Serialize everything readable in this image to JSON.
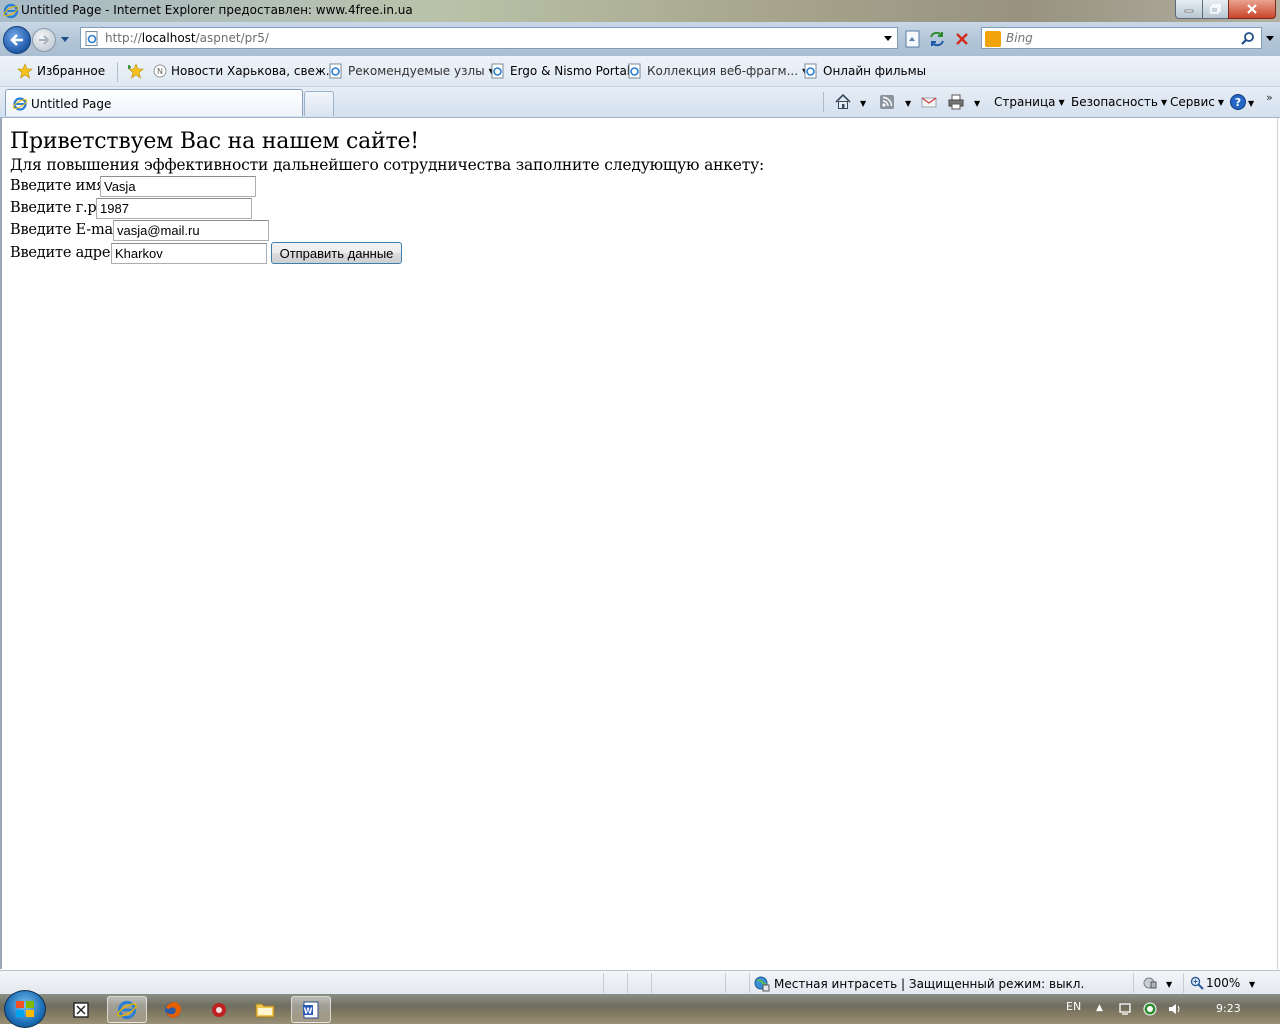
{
  "window": {
    "title": "Untitled Page - Internet Explorer предоставлен: www.4free.in.ua"
  },
  "nav": {
    "url_prefix": "http://",
    "url_host": "localhost",
    "url_path": "/aspnet/pr5/",
    "search_placeholder": "Bing"
  },
  "favorites": {
    "label": "Избранное",
    "items": [
      {
        "label": "Новости Харькова, свеж..."
      },
      {
        "label": "Рекомендуемые узлы"
      },
      {
        "label": "Ergo & Nismo Portal"
      },
      {
        "label": "Коллекция веб-фрагм..."
      },
      {
        "label": "Онлайн фильмы"
      }
    ]
  },
  "tabs": [
    {
      "label": "Untitled Page"
    }
  ],
  "commands": {
    "page": "Страница",
    "security": "Безопасность",
    "tools": "Сервис"
  },
  "page": {
    "greeting": "Приветствуем Вас на нашем сайте!",
    "intro": "Для повышения эффективности дальнейшего сотрудничества заполните следующую анкету:",
    "fields": [
      {
        "label": "Введите имя",
        "value": "Vasja"
      },
      {
        "label": "Введите г.р.",
        "value": "1987"
      },
      {
        "label": "Введите E-mail",
        "value": "vasja@mail.ru"
      },
      {
        "label": "Введите адрес",
        "value": "Kharkov"
      }
    ],
    "submit_label": "Отправить данные"
  },
  "status": {
    "zone": "Местная интрасеть | Защищенный режим: выкл.",
    "zoom": "100%"
  },
  "taskbar": {
    "language": "EN",
    "clock": "9:23"
  },
  "colors": {
    "accent": "#1f5aa8",
    "link_blue": "#3c7fb1",
    "close_red": "#c8452a",
    "bing_orange": "#f0a30a"
  }
}
